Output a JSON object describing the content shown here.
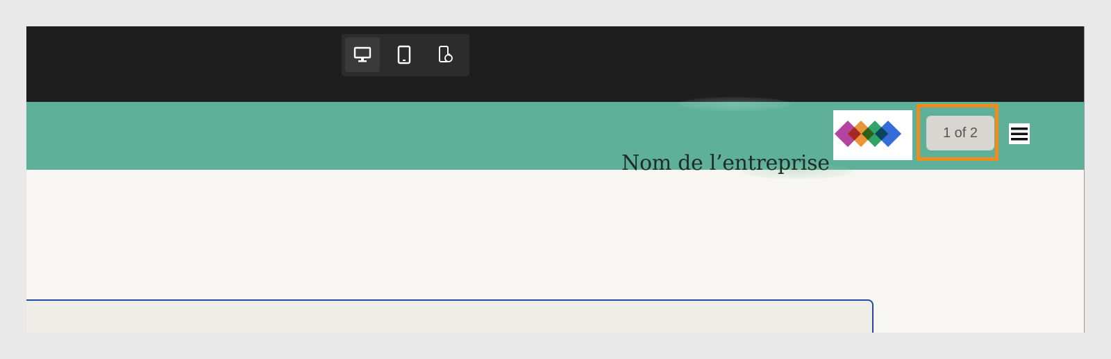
{
  "toolbar": {
    "devices": [
      {
        "name": "desktop",
        "icon": "desktop-icon",
        "active": true
      },
      {
        "name": "tablet",
        "icon": "tablet-icon",
        "active": false
      },
      {
        "name": "mobile-rotate",
        "icon": "mobile-rotate-icon",
        "active": false
      }
    ]
  },
  "header": {
    "company_name": "Nom de l’entreprise",
    "logo_colors": [
      "#b03a9a",
      "#e88a22",
      "#1a9a5a",
      "#1f5cd6"
    ],
    "pager_label": "1 of 2",
    "menu_icon": "hamburger-icon"
  },
  "colors": {
    "topbar": "#1e1e1e",
    "header": "#5eb198",
    "highlight": "#f08c1e",
    "card_border": "#2447a6",
    "page_bg": "#f7f6f3"
  }
}
